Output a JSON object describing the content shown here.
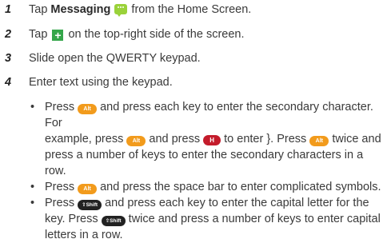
{
  "steps": [
    {
      "num": "1",
      "pre": "Tap ",
      "bold": "Messaging",
      "icon": "messaging-icon",
      "post": " from the Home Screen."
    },
    {
      "num": "2",
      "pre": "Tap ",
      "icon": "plus-icon",
      "post": " on the top-right side of the screen."
    },
    {
      "num": "3",
      "text": "Slide open the QWERTY keypad."
    },
    {
      "num": "4",
      "text": "Enter text using the keypad."
    }
  ],
  "keys": {
    "alt": "Alt",
    "h": "H",
    "shift": "⇧Shift"
  },
  "bullets": {
    "b1": {
      "l1a": "Press ",
      "l1b": " and press each key to enter the secondary character. For",
      "l2a": "example, press ",
      "l2b": " and press ",
      "l2c": " to enter }. Press ",
      "l2d": " twice and",
      "l3": "press a number of keys to enter the secondary characters in a row."
    },
    "b2": {
      "a": "Press ",
      "b": " and press the space bar to enter complicated symbols."
    },
    "b3": {
      "l1a": "Press ",
      "l1b": " and press each key to enter the capital letter for the",
      "l2a": "key. Press ",
      "l2b": " twice and press a number of keys to enter capital",
      "l3": "letters in a row."
    }
  },
  "colors": {
    "alt_key": "#f29b1c",
    "h_key": "#c41c2b",
    "shift_key": "#222222",
    "plus_icon": "#35a64a",
    "messaging_icon": "#9ad23a"
  }
}
